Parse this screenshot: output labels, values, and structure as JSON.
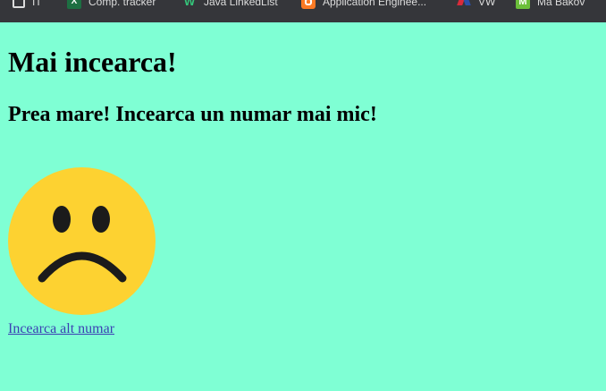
{
  "bookmarks": [
    {
      "label": "IT",
      "icon": "folder-icon"
    },
    {
      "label": "Comp. tracker",
      "icon": "excel-icon"
    },
    {
      "label": "Java LinkedList",
      "icon": "w-logo-icon"
    },
    {
      "label": "Application Enginee...",
      "icon": "xampp-icon"
    },
    {
      "label": "VW",
      "icon": "vw-icon"
    },
    {
      "label": "Ma Bakov",
      "icon": "mb-icon"
    }
  ],
  "page": {
    "title": "Mai incearca!",
    "message": "Prea mare! Incearca un numar mai mic!",
    "face_icon": "sad-face-icon",
    "retry_link": "Incearca alt numar"
  },
  "colors": {
    "background": "#7fffd4",
    "face": "#fdd231",
    "features": "#1b1b1b",
    "link": "#3b3fb3",
    "bookmarks_bar": "#35363a"
  }
}
